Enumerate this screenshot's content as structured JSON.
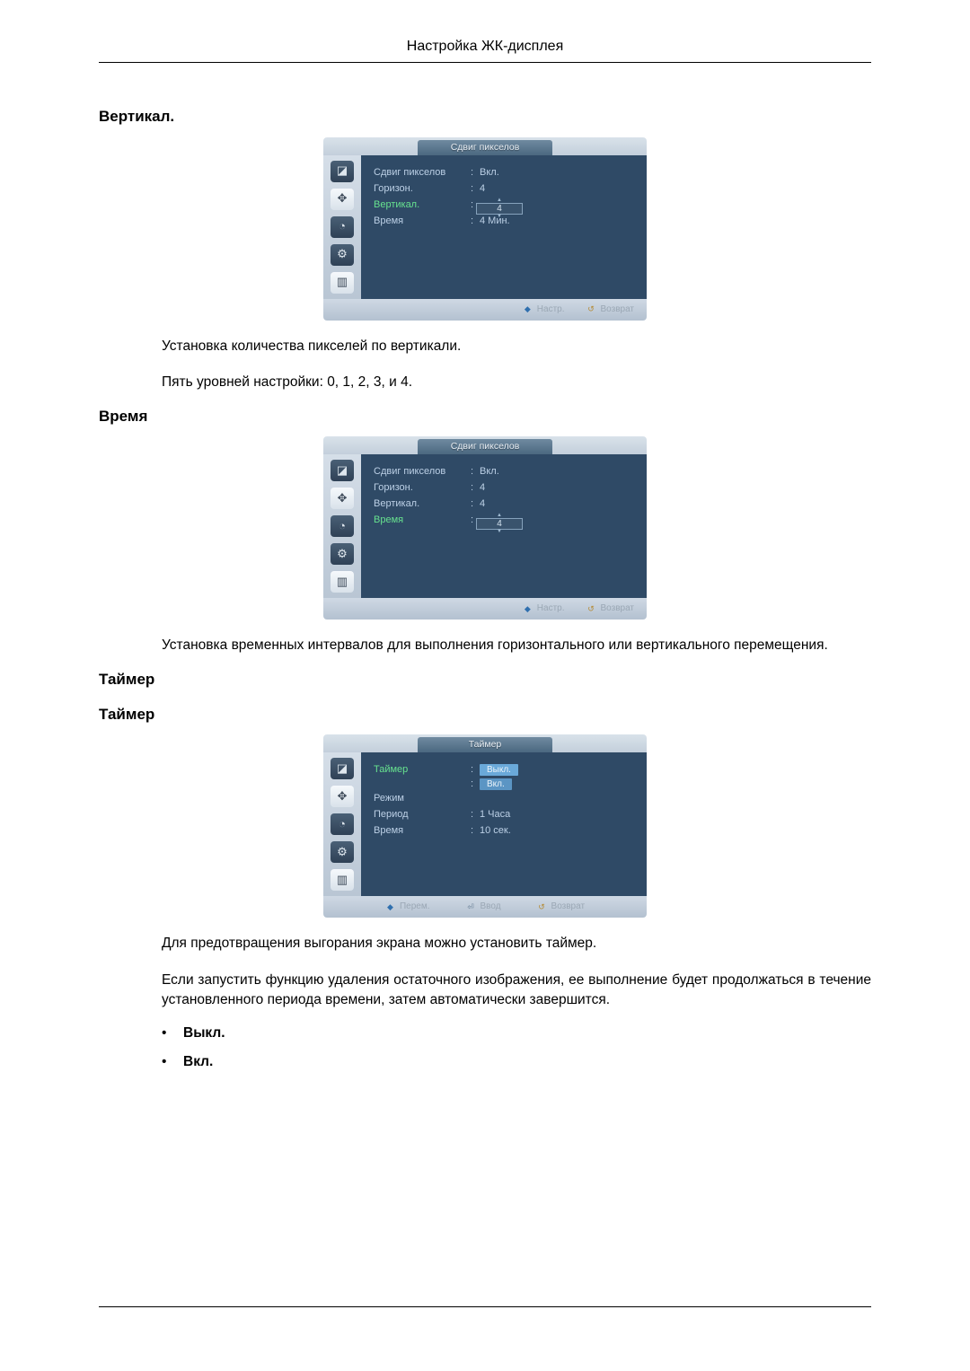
{
  "header": {
    "title": "Настройка ЖК-дисплея"
  },
  "sections": {
    "vertical": {
      "title": "Вертикал.",
      "osd": {
        "tab_title": "Сдвиг пикселов",
        "rows": {
          "pixel_shift": {
            "label": "Сдвиг пикселов",
            "value": "Вкл."
          },
          "horizon": {
            "label": "Горизон.",
            "value": "4"
          },
          "vertical": {
            "label": "Вертикал.",
            "spinner": "4"
          },
          "time": {
            "label": "Время",
            "value": "4 Мин."
          }
        },
        "footer": {
          "adjust": "Настр.",
          "return": "Возврат"
        }
      },
      "text1": "Установка количества пикселей по вертикали.",
      "text2": "Пять уровней настройки: 0, 1, 2, 3, и 4."
    },
    "time": {
      "title": "Время",
      "osd": {
        "tab_title": "Сдвиг пикселов",
        "rows": {
          "pixel_shift": {
            "label": "Сдвиг пикселов",
            "value": "Вкл."
          },
          "horizon": {
            "label": "Горизон.",
            "value": "4"
          },
          "vertical": {
            "label": "Вертикал.",
            "value": "4"
          },
          "time": {
            "label": "Время",
            "spinner": "4"
          }
        },
        "footer": {
          "adjust": "Настр.",
          "return": "Возврат"
        }
      },
      "text1": "Установка временных интервалов для выполнения горизонтального или вертикального перемещения."
    },
    "timer": {
      "title1": "Таймер",
      "title2": "Таймер",
      "osd": {
        "tab_title": "Таймер",
        "rows": {
          "timer": {
            "label": "Таймер",
            "selected": "Выкл.",
            "alt": "Вкл."
          },
          "mode": {
            "label": "Режим"
          },
          "period": {
            "label": "Период",
            "value": "1 Часа"
          },
          "time": {
            "label": "Время",
            "value": "10 сек."
          }
        },
        "footer": {
          "move": "Перем.",
          "enter": "Ввод",
          "return": "Возврат"
        }
      },
      "text1": "Для предотвращения выгорания экрана можно установить таймер.",
      "text2": "Если запустить функцию удаления остаточного изображения, ее выполнение будет продолжаться в течение установленного периода времени, затем автоматически завершится.",
      "bullets": {
        "off": "Выкл.",
        "on": "Вкл."
      }
    }
  },
  "icons": {
    "i1": "image-icon",
    "i2": "adjust-icon",
    "i3": "clock-icon",
    "i4": "gear-icon",
    "i5": "chart-icon"
  }
}
